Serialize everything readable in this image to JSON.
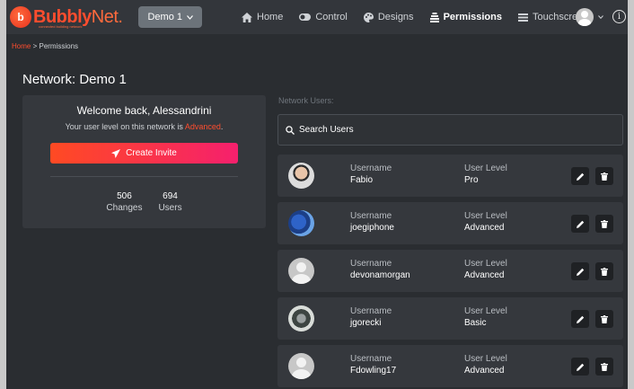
{
  "brand": {
    "name_main": "Bubbly",
    "name_suffix": "Net.",
    "tagline": "connected building network",
    "accent": "#ff4d2e"
  },
  "network_select": {
    "label": "Demo 1"
  },
  "nav": [
    {
      "label": "Home",
      "icon": "home-icon",
      "active": false
    },
    {
      "label": "Control",
      "icon": "toggle-icon",
      "active": false
    },
    {
      "label": "Designs",
      "icon": "palette-icon",
      "active": false
    },
    {
      "label": "Permissions",
      "icon": "permissions-icon",
      "active": true
    },
    {
      "label": "Touchscreens",
      "icon": "touchscreen-icon",
      "active": false
    }
  ],
  "breadcrumb": {
    "home": "Home",
    "sep": ">",
    "current": "Permissions"
  },
  "page_title": "Network: Demo 1",
  "welcome": {
    "greeting": "Welcome back, Alessandrini",
    "level_prefix": "Your user level on this network is",
    "level_value": "Advanced",
    "level_suffix": ".",
    "invite_button": "Create Invite",
    "stats": [
      {
        "value": "506",
        "label": "Changes"
      },
      {
        "value": "694",
        "label": "Users"
      }
    ]
  },
  "users_section": {
    "label": "Network Users:",
    "search_placeholder": "Search Users",
    "username_caption": "Username",
    "level_caption": "User Level",
    "users": [
      {
        "username": "Fabio",
        "level": "Pro"
      },
      {
        "username": "joegiphone",
        "level": "Advanced"
      },
      {
        "username": "devonamorgan",
        "level": "Advanced"
      },
      {
        "username": "jgorecki",
        "level": "Basic"
      },
      {
        "username": "Fdowling17",
        "level": "Advanced"
      }
    ]
  }
}
